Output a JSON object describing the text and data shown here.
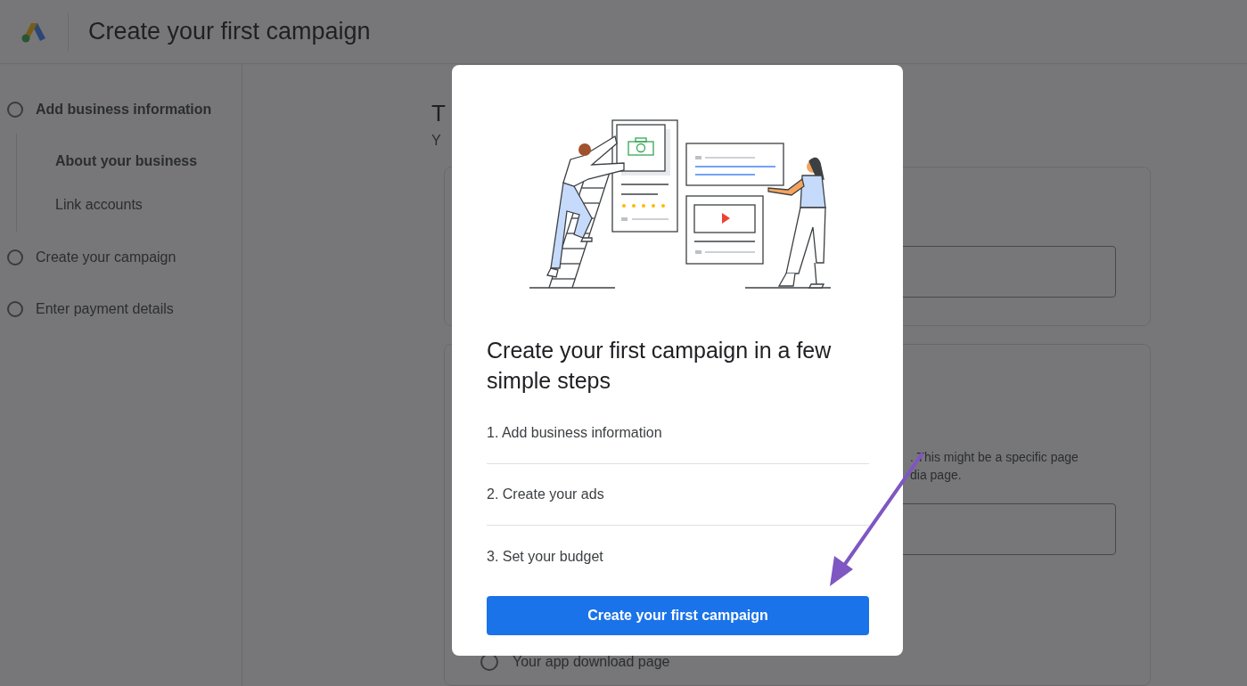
{
  "header": {
    "title": "Create your first campaign"
  },
  "steps": [
    {
      "label": "Add business information",
      "selected": true,
      "children": [
        {
          "label": "About your business",
          "selected": true
        },
        {
          "label": "Link accounts",
          "selected": false
        }
      ]
    },
    {
      "label": "Create your campaign",
      "selected": false
    },
    {
      "label": "Enter payment details",
      "selected": false
    }
  ],
  "main": {
    "heading_fragment": "T",
    "subtitle_fragment": "Y",
    "description_fragment_lines": [
      ". This might be a specific page",
      "dia page."
    ],
    "radio_option": {
      "label": "Your app download page",
      "selected": false
    }
  },
  "dialog": {
    "heading": "Create your first campaign in a few simple steps",
    "steps": [
      "1. Add business information",
      "2. Create your ads",
      "3. Set your budget"
    ],
    "button": "Create your first campaign"
  }
}
